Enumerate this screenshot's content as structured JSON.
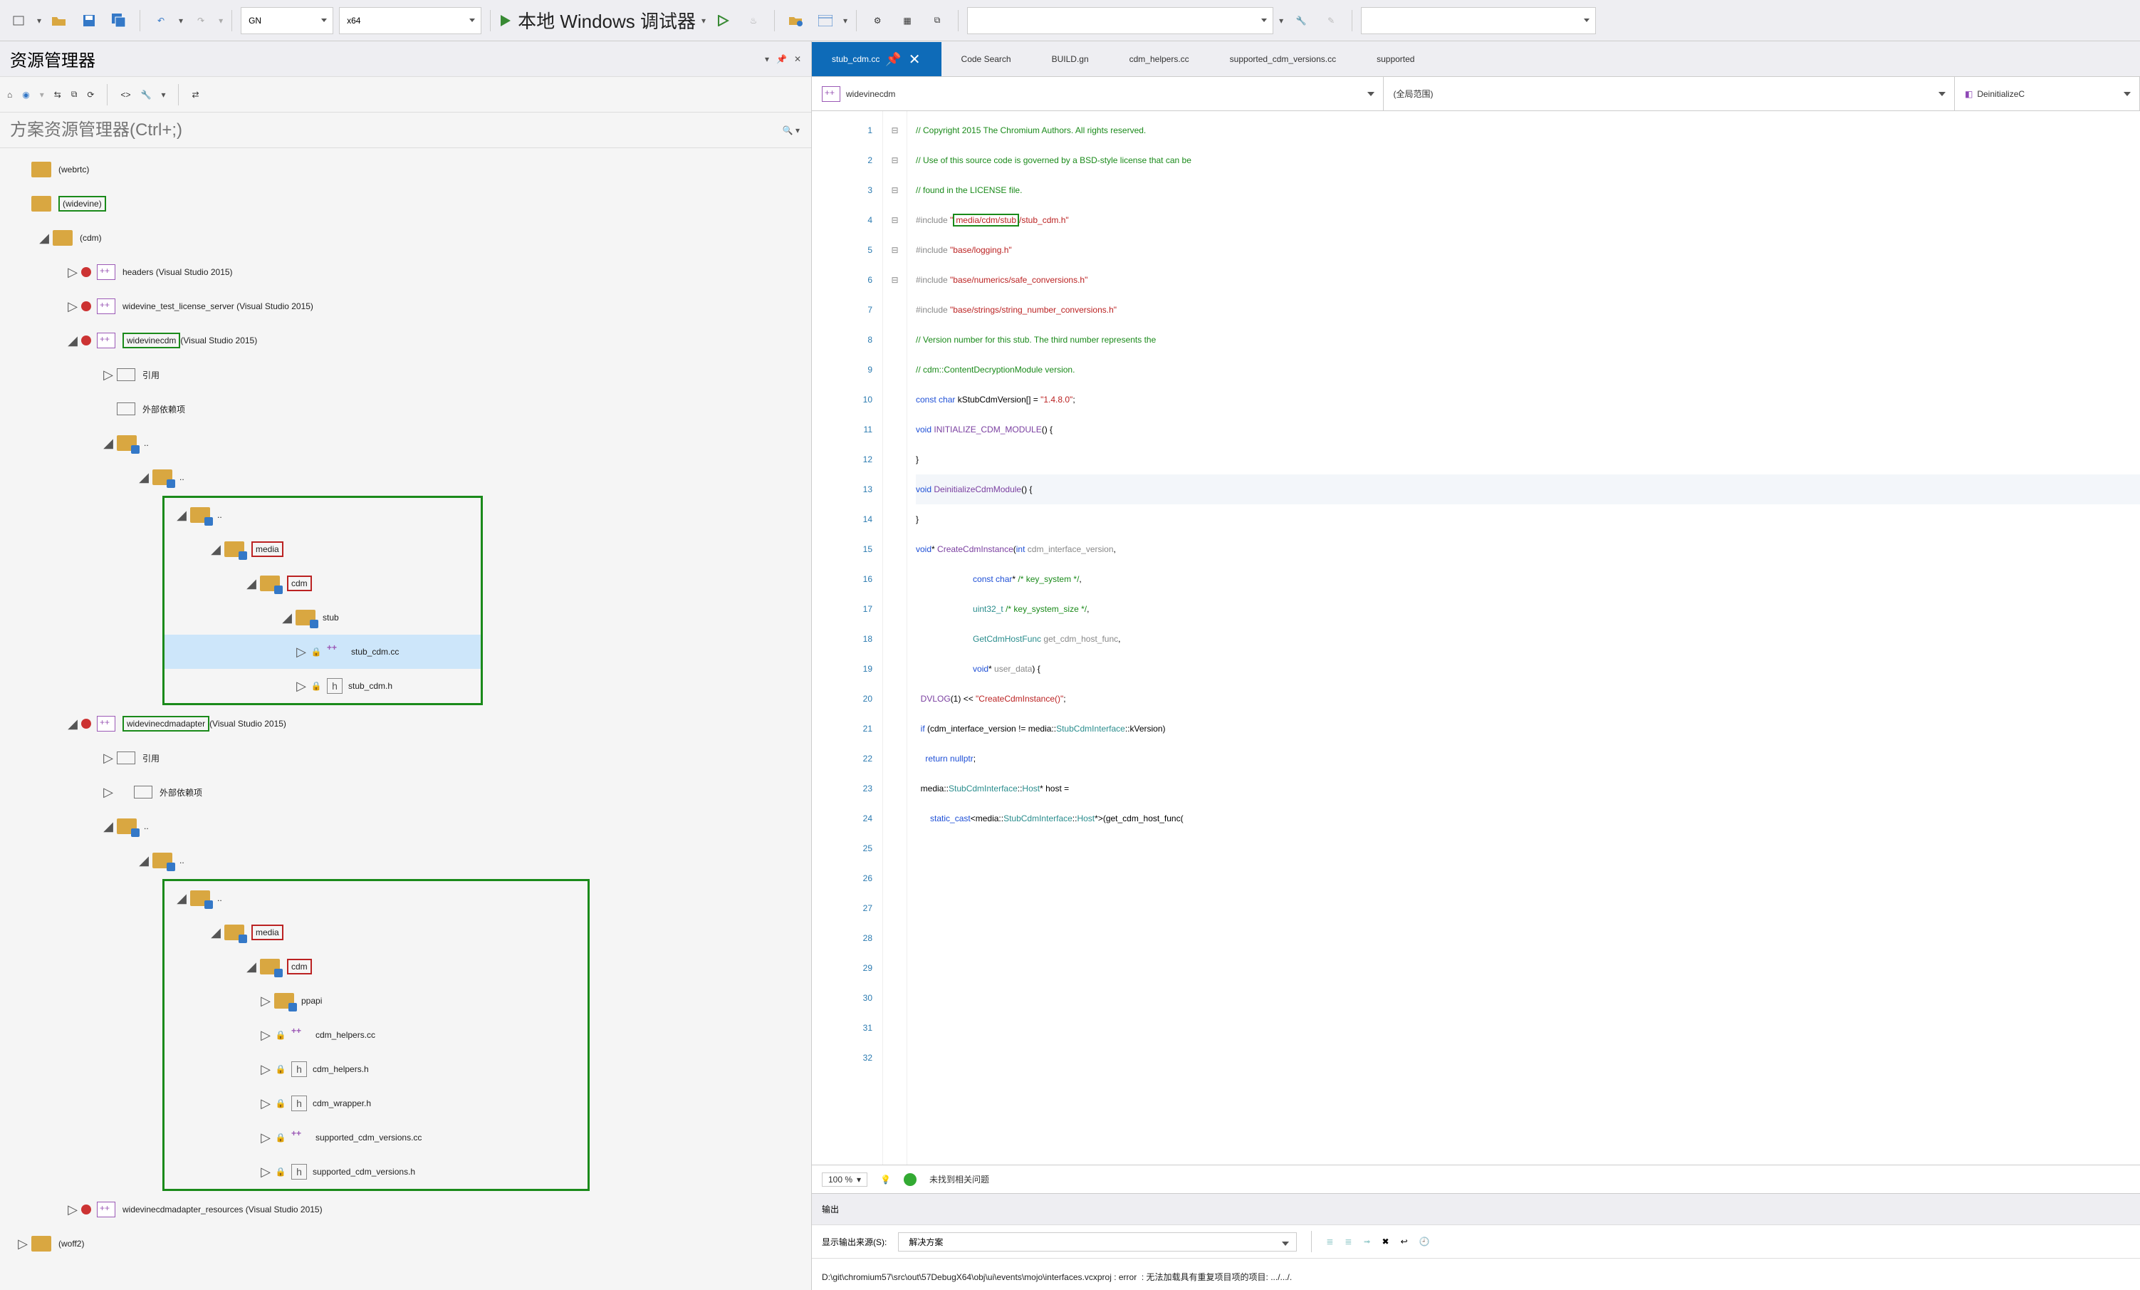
{
  "toolbar": {
    "config": "GN",
    "platform": "x64",
    "debug": "本地 Windows 调试器"
  },
  "panel": {
    "title": "资源管理器",
    "search_ph": "方案资源管理器(Ctrl+;)"
  },
  "tree": {
    "webrtc": "(webrtc)",
    "widevine": "(widevine)",
    "cdm": "(cdm)",
    "headers": "headers (Visual Studio 2015)",
    "licsrv": "widevine_test_license_server (Visual Studio 2015)",
    "wvcdm": "widevinecdm",
    "wvcdm_suffix": "(Visual Studio 2015)",
    "ref": "引用",
    "extdep": "外部依赖项",
    "dots": "..",
    "media": "media",
    "cdmf": "cdm",
    "stub": "stub",
    "stub_cc": "stub_cdm.cc",
    "stub_h": "stub_cdm.h",
    "adapter": "widevinecdmadapter",
    "adapter_suffix": "(Visual Studio 2015)",
    "ppapi": "ppapi",
    "helpers_cc": "cdm_helpers.cc",
    "helpers_h": "cdm_helpers.h",
    "wrapper_h": "cdm_wrapper.h",
    "sup_cc": "supported_cdm_versions.cc",
    "sup_h": "supported_cdm_versions.h",
    "res": "widevinecdmadapter_resources (Visual Studio 2015)",
    "woff2": "(woff2)"
  },
  "tabs": {
    "t1": "stub_cdm.cc",
    "t2": "Code Search",
    "t3": "BUILD.gn",
    "t4": "cdm_helpers.cc",
    "t5": "supported_cdm_versions.cc",
    "t6": "supported"
  },
  "nav": {
    "proj": "widevinecdm",
    "scope": "(全局范围)",
    "func": "DeinitializeC"
  },
  "code_lines": [
    {
      "n": 1,
      "h": "// Copyright 2015 The Chromium Authors. All rights reserved.",
      "cls": "cgreen"
    },
    {
      "n": 2,
      "h": "// Use of this source code is governed by a BSD-style license that can be",
      "cls": "cgreen"
    },
    {
      "n": 3,
      "h": "// found in the LICENSE file.",
      "cls": "cgreen"
    },
    {
      "n": 4,
      "h": "",
      "cls": ""
    },
    {
      "n": 5,
      "h": "INCLUDE_STUB",
      "cls": ""
    },
    {
      "n": 6,
      "h": "",
      "cls": ""
    },
    {
      "n": 7,
      "h": "#include \"base/logging.h\"",
      "cls": "inc"
    },
    {
      "n": 8,
      "h": "#include \"base/numerics/safe_conversions.h\"",
      "cls": "inc"
    },
    {
      "n": 9,
      "h": "#include \"base/strings/string_number_conversions.h\"",
      "cls": "inc"
    },
    {
      "n": 10,
      "h": "",
      "cls": ""
    },
    {
      "n": 11,
      "h": "// Version number for this stub. The third number represents the",
      "cls": "cgreen"
    },
    {
      "n": 12,
      "h": "// cdm::ContentDecryptionModule version.",
      "cls": "cgreen"
    },
    {
      "n": 13,
      "h": "const char kStubCdmVersion[] = \"1.4.8.0\";",
      "cls": "mix1"
    },
    {
      "n": 14,
      "h": "",
      "cls": ""
    },
    {
      "n": 15,
      "h": "void INITIALIZE_CDM_MODULE() {",
      "cls": "mix2"
    },
    {
      "n": 16,
      "h": "}",
      "cls": ""
    },
    {
      "n": 17,
      "h": "",
      "cls": ""
    },
    {
      "n": 18,
      "h": "void DeinitializeCdmModule() {",
      "cls": "mix2",
      "sel": true
    },
    {
      "n": 19,
      "h": "}",
      "cls": ""
    },
    {
      "n": 20,
      "h": "",
      "cls": ""
    },
    {
      "n": 21,
      "h": "void* CreateCdmInstance(int cdm_interface_version,",
      "cls": "mix3"
    },
    {
      "n": 22,
      "h": "                        const char* /* key_system */,",
      "cls": "mix4"
    },
    {
      "n": 23,
      "h": "                        uint32_t /* key_system_size */,",
      "cls": "mix4"
    },
    {
      "n": 24,
      "h": "                        GetCdmHostFunc get_cdm_host_func,",
      "cls": "mix4"
    },
    {
      "n": 25,
      "h": "                        void* user_data) {",
      "cls": "mix4"
    },
    {
      "n": 26,
      "h": "  DVLOG(1) << \"CreateCdmInstance()\";",
      "cls": "mix5"
    },
    {
      "n": 27,
      "h": "",
      "cls": ""
    },
    {
      "n": 28,
      "h": "  if (cdm_interface_version != media::StubCdmInterface::kVersion)",
      "cls": "mix6"
    },
    {
      "n": 29,
      "h": "    return nullptr;",
      "cls": "mix7"
    },
    {
      "n": 30,
      "h": "",
      "cls": ""
    },
    {
      "n": 31,
      "h": "  media::StubCdmInterface::Host* host =",
      "cls": "mix6"
    },
    {
      "n": 32,
      "h": "      static_cast<media::StubCdmInterface::Host*>(get_cdm_host_func(",
      "cls": "mix6"
    }
  ],
  "status": {
    "zoom": "100 %",
    "issues": "未找到相关问题"
  },
  "output": {
    "title": "输出",
    "srclbl": "显示输出来源(S):",
    "src": "解决方案",
    "line": "D:\\git\\chromium57\\src\\out\\57DebugX64\\obj\\ui\\events\\mojo\\interfaces.vcxproj : error  : 无法加载具有重复项目项的项目: .../.../."
  }
}
